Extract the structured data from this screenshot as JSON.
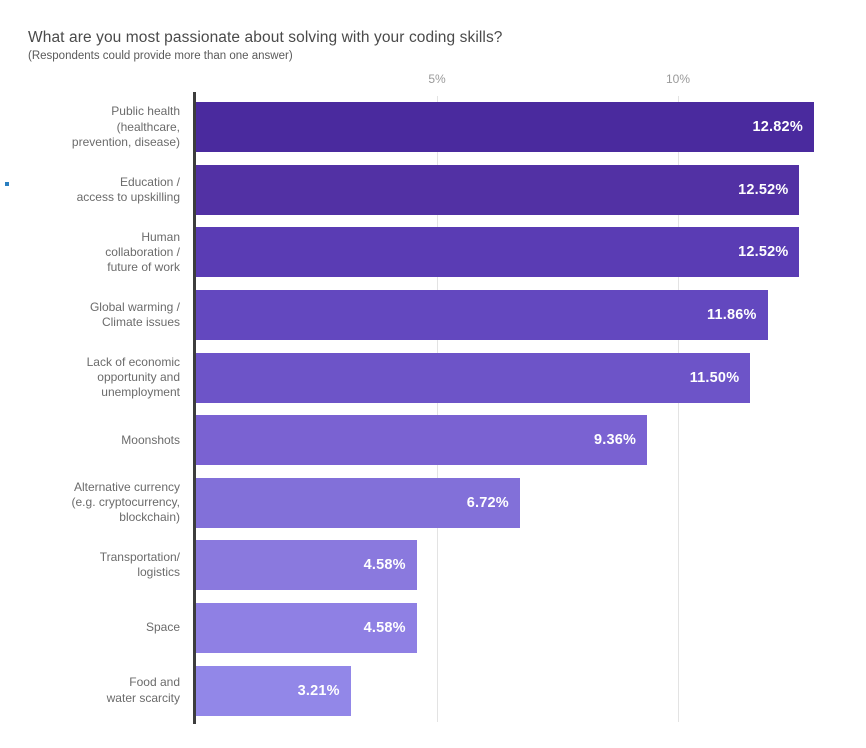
{
  "chart_data": {
    "type": "bar",
    "orientation": "horizontal",
    "title": "What are you most passionate about solving with your coding skills?",
    "subtitle": "(Respondents could provide more than one answer)",
    "xlabel": "",
    "ylabel": "",
    "xlim": [
      0,
      13.9
    ],
    "grid": true,
    "gridlines": [
      5,
      10
    ],
    "tick_labels": [
      "5%",
      "10%"
    ],
    "legend": "none",
    "value_label_format": "0.00%",
    "categories": [
      "Public health\n(healthcare,\nprevention, disease)",
      "Education /\naccess to upskilling",
      "Human\ncollaboration /\nfuture of work",
      "Global warming /\nClimate issues",
      "Lack of economic\nopportunity and\nunemployment",
      "Moonshots",
      "Alternative currency\n(e.g. cryptocurrency,\nblockchain)",
      "Transportation/\nlogistics",
      "Space",
      "Food and\nwater scarcity"
    ],
    "values": [
      12.82,
      12.52,
      12.52,
      11.86,
      11.5,
      9.36,
      6.72,
      4.58,
      4.58,
      3.21
    ],
    "value_labels": [
      "12.82%",
      "12.52%",
      "12.52%",
      "11.86%",
      "11.50%",
      "9.36%",
      "6.72%",
      "4.58%",
      "4.58%",
      "3.21%"
    ],
    "bar_colors": [
      "#4a2a9e",
      "#5231a4",
      "#5a3cb4",
      "#6348bf",
      "#6d54c8",
      "#7a62d2",
      "#8270d9",
      "#8a79de",
      "#8f80e4",
      "#9287e8"
    ],
    "value_label_color": "#ffffff",
    "category_label_color": "#6b6b6b",
    "tick_label_color": "#9a9a9a",
    "axis_color": "#3d3d3d",
    "gridline_color": "#e3e3e3"
  }
}
